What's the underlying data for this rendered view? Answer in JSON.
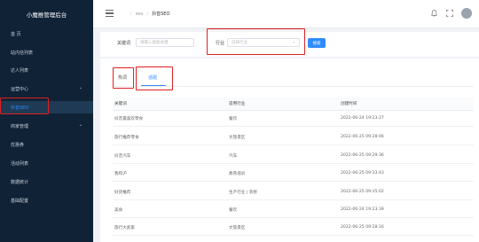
{
  "sidebar": {
    "brand": "小魔推管理后台",
    "items": [
      {
        "label": "首 页",
        "arrow": ""
      },
      {
        "label": "站内信列表",
        "arrow": ""
      },
      {
        "label": "达人列表",
        "arrow": ""
      },
      {
        "label": "运营中心",
        "arrow": "⌄"
      },
      {
        "label": "抖音SEO",
        "arrow": ""
      },
      {
        "label": "商家管理",
        "arrow": "⌄"
      },
      {
        "label": "优惠券",
        "arrow": ""
      },
      {
        "label": "活动列表",
        "arrow": ""
      },
      {
        "label": "数据统计",
        "arrow": ""
      },
      {
        "label": "基础配置",
        "arrow": ""
      }
    ]
  },
  "topbar": {
    "breadcrumb": [
      "seo",
      "抖音SEO"
    ],
    "icons": [
      "bell-icon",
      "fullscreen-icon",
      "avatar"
    ]
  },
  "filter": {
    "keyword_label": "关键词",
    "keyword_placeholder": "请输入搜索关键",
    "industry_label": "行业",
    "industry_placeholder": "选择行业",
    "search_label": "搜索"
  },
  "tabs": [
    {
      "label": "热词"
    },
    {
      "label": "话题"
    }
  ],
  "table": {
    "headers": [
      "关键词",
      "适用行业",
      "创建时间"
    ],
    "rows": [
      [
        "抖音最喜欢零食",
        "餐饮",
        "2022-06-24 19:23:27"
      ],
      [
        "旅行推荐零食",
        "文旅景区",
        "2022-06-25 09:28:06"
      ],
      [
        "抖音汽车",
        "汽车",
        "2022-06-25 09:29:36"
      ],
      [
        "我和沪",
        "教育培训",
        "2022-06-25 09:33:43"
      ],
      [
        "好货推荐",
        "生产行业 | 装修",
        "2022-06-25 09:35:02"
      ],
      [
        "美食",
        "餐饮",
        "2022-06-24 19:23:39"
      ],
      [
        "旅行大武家",
        "文旅景区",
        "2022-06-25 09:28:16"
      ]
    ]
  },
  "colors": {
    "sidebar_bg": "#0f2236",
    "accent": "#2f8cff",
    "highlight": "#e02020"
  }
}
